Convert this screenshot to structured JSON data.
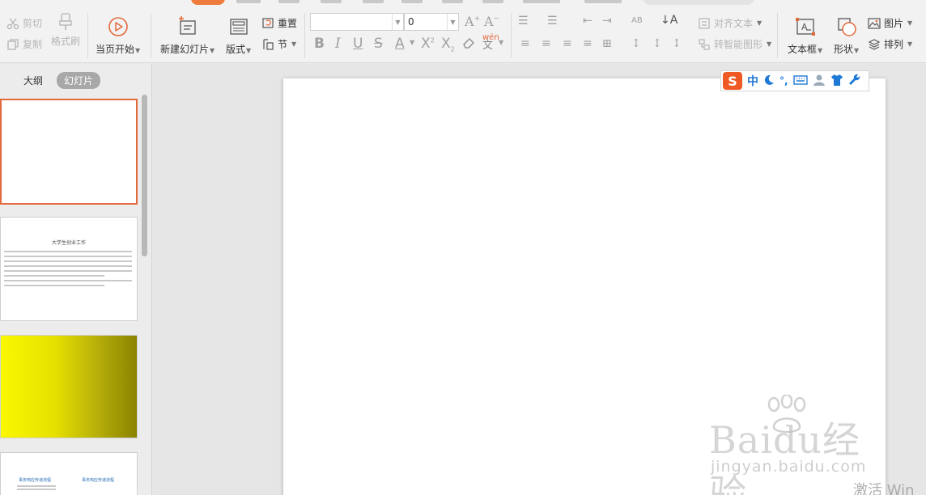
{
  "ribbon": {
    "cut": "剪切",
    "copy": "复制",
    "format_painter": "格式刷",
    "play_from_current": "当页开始",
    "new_slide": "新建幻灯片",
    "layout": "版式",
    "reset": "重置",
    "section": "节",
    "font_name": "",
    "font_size": "0",
    "align_text": "对齐文本",
    "convert_smartart": "转智能图形",
    "textbox": "文本框",
    "shape": "形状",
    "picture": "图片",
    "arrange": "排列"
  },
  "left_panel": {
    "tab_outline": "大纲",
    "tab_slides": "幻灯片",
    "slide2_title": "大学生创业工作",
    "slide4_heading_left": "事务响应传递流程",
    "slide4_heading_right": "事务响应传递流程"
  },
  "ime": {
    "logo": "S",
    "mode": "中",
    "punct": "°,"
  },
  "watermark": {
    "brand": "Baidu经验",
    "domain": "jingyan.baidu.com",
    "activate": "激活 Win"
  }
}
